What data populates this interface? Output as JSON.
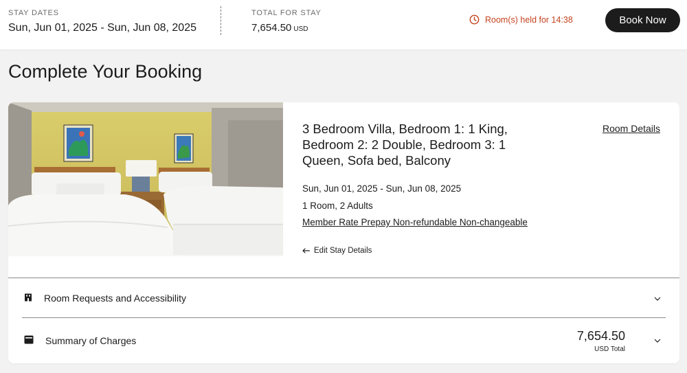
{
  "header": {
    "stay_dates_label": "STAY DATES",
    "stay_dates_value": "Sun, Jun 01, 2025 - Sun, Jun 08, 2025",
    "total_label": "TOTAL FOR STAY",
    "total_value": "7,654.50",
    "total_currency": "USD",
    "hold_text": "Room(s) held for 14:38",
    "book_button": "Book Now"
  },
  "page": {
    "title": "Complete Your Booking"
  },
  "room": {
    "name": "3 Bedroom Villa, Bedroom 1: 1 King, Bedroom 2: 2 Double, Bedroom 3: 1 Queen, Sofa bed, Balcony",
    "details_link": "Room Details",
    "dates": "Sun, Jun 01, 2025 - Sun, Jun 08, 2025",
    "guests": "1 Room, 2 Adults",
    "rate": "Member Rate Prepay Non-refundable Non-changeable",
    "edit_link": "Edit Stay Details"
  },
  "sections": {
    "requests_label": "Room Requests and Accessibility",
    "charges_label": "Summary of Charges",
    "charges_amount": "7,654.50",
    "charges_unit": "USD Total"
  },
  "icons": {
    "clock": "clock-icon",
    "arrow_left": "arrow-left-icon",
    "building": "building-icon",
    "wallet": "wallet-icon",
    "chevron": "chevron-down-icon"
  },
  "colors": {
    "alert": "#c4431e",
    "button_bg": "#1c1c1c",
    "page_bg": "#f2f2f2"
  }
}
